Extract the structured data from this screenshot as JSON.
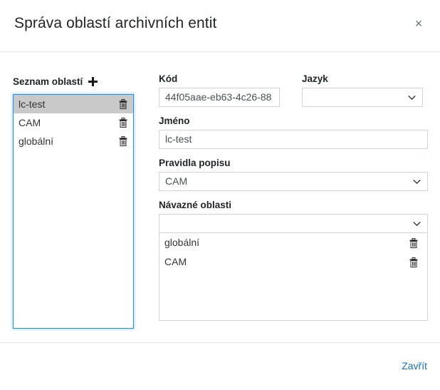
{
  "dialog": {
    "title": "Správa oblastí archivních entit",
    "close_icon": "close-icon",
    "close_label": "×"
  },
  "areas_panel": {
    "heading": "Seznam oblastí",
    "add_icon": "plus-icon",
    "items": [
      {
        "label": "lc-test",
        "selected": true,
        "delete_icon": "trash-icon"
      },
      {
        "label": "CAM",
        "selected": false,
        "delete_icon": "trash-icon"
      },
      {
        "label": "globální",
        "selected": false,
        "delete_icon": "trash-icon"
      }
    ]
  },
  "form": {
    "code": {
      "label": "Kód",
      "value": "44f05aae-eb63-4c26-88",
      "placeholder": ""
    },
    "language": {
      "label": "Jazyk",
      "value": "",
      "placeholder": "",
      "chevron_icon": "chevron-down-icon"
    },
    "name": {
      "label": "Jméno",
      "value": "lc-test",
      "placeholder": ""
    },
    "rules": {
      "label": "Pravidla popisu",
      "value": "CAM",
      "chevron_icon": "chevron-down-icon"
    },
    "linked_areas": {
      "label": "Návazné oblasti",
      "select_value": "",
      "chevron_icon": "chevron-down-icon",
      "items": [
        {
          "label": "globální",
          "delete_icon": "trash-icon"
        },
        {
          "label": "CAM",
          "delete_icon": "trash-icon"
        }
      ]
    }
  },
  "footer": {
    "close_label": "Zavřít"
  },
  "colors": {
    "focus_border": "#1e90e8",
    "selected_row": "#c9c9c9",
    "link": "#1a6fb5",
    "field_border": "#ced4da",
    "divider": "#e6e6e6"
  }
}
